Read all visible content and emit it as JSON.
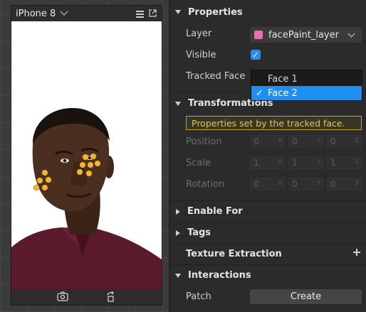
{
  "viewport": {
    "device_name": "iPhone 8",
    "icons": [
      "chevron-down-icon",
      "hamburger-menu-icon",
      "popout-icon",
      "camera-switch-icon",
      "rotate-icon"
    ]
  },
  "inspector": {
    "properties": {
      "title": "Properties",
      "layer_label": "Layer",
      "layer_value": "facePaint_layer",
      "layer_color": "#e86fb0",
      "visible_label": "Visible",
      "visible_checked": true,
      "tracked_face_label": "Tracked Face",
      "tracked_face_options": [
        "Face 1",
        "Face 2"
      ],
      "tracked_face_selected": "Face 2",
      "check_mark": "✓"
    },
    "transformations": {
      "title": "Transformations",
      "note": "Properties set by the tracked face.",
      "position_label": "Position",
      "scale_label": "Scale",
      "rotation_label": "Rotation",
      "position_values": [
        "0",
        "0",
        "0"
      ],
      "scale_values": [
        "1",
        "1",
        "1"
      ],
      "rotation_values": [
        "0",
        "0",
        "0"
      ],
      "axis_labels": [
        "X",
        "Y",
        "Z"
      ]
    },
    "enable_for": {
      "title": "Enable For"
    },
    "tags": {
      "title": "Tags"
    },
    "texture_extraction": {
      "title": "Texture Extraction"
    },
    "interactions": {
      "title": "Interactions",
      "patch_label": "Patch",
      "create_label": "Create"
    }
  },
  "colors": {
    "accent": "#1e8ef0",
    "warning_text": "#e8c34a",
    "warning_border": "#c9a227"
  }
}
